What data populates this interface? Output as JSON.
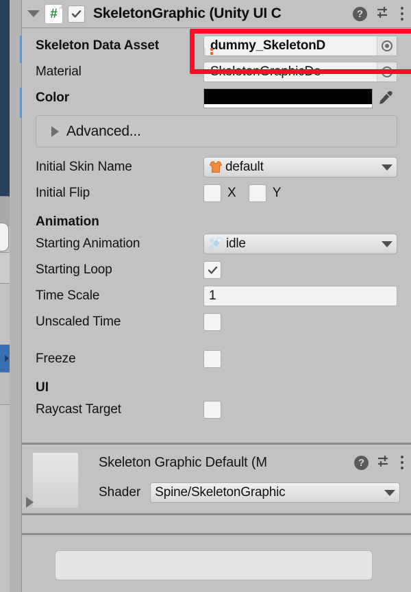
{
  "component": {
    "title": "SkeletonGraphic (Unity UI C",
    "enabled": true,
    "expanded": true,
    "script_icon": "script-csharp-icon",
    "header_icons": {
      "help": "?",
      "preset": "preset-icon",
      "menu": "kebab-menu-icon"
    }
  },
  "fields": {
    "skeleton_data_asset": {
      "label": "Skeleton Data Asset",
      "value": "dummy_SkeletonD",
      "icon": "spine-skeleton-data-icon"
    },
    "material": {
      "label": "Material",
      "value": "SkeletonGraphicDe",
      "icon": "material-sphere-icon"
    },
    "color": {
      "label": "Color",
      "value": "#000000",
      "alpha_strip": "#FFFFFF",
      "eyedropper": "eyedropper-icon"
    },
    "advanced": {
      "label": "Advanced...",
      "expanded": false
    },
    "initial_skin_name": {
      "label": "Initial Skin Name",
      "value": "default",
      "icon": "spine-skin-icon"
    },
    "initial_flip": {
      "label": "Initial Flip",
      "x_label": "X",
      "y_label": "Y",
      "x_checked": false,
      "y_checked": false
    },
    "animation_section": {
      "label": "Animation"
    },
    "starting_animation": {
      "label": "Starting Animation",
      "value": "idle",
      "icon": "spine-animation-icon"
    },
    "starting_loop": {
      "label": "Starting Loop",
      "checked": true
    },
    "time_scale": {
      "label": "Time Scale",
      "value": "1"
    },
    "unscaled_time": {
      "label": "Unscaled Time",
      "checked": false
    },
    "freeze": {
      "label": "Freeze",
      "checked": false
    },
    "ui_section": {
      "label": "UI"
    },
    "raycast_target": {
      "label": "Raycast Target",
      "checked": false
    }
  },
  "material_block": {
    "title": "Skeleton Graphic Default (M",
    "shader_label": "Shader",
    "shader_value": "Spine/SkeletonGraphic",
    "help": "?",
    "preset": "preset-icon",
    "menu": "kebab-menu-icon"
  },
  "annotation": {
    "highlight_color": "#FF0D24"
  },
  "colors": {
    "panel_bg": "#C2C2C2",
    "prefab_override": "#4A9CE8",
    "dark_panel": "#27405C",
    "accent_blue": "#3B6EB0"
  }
}
